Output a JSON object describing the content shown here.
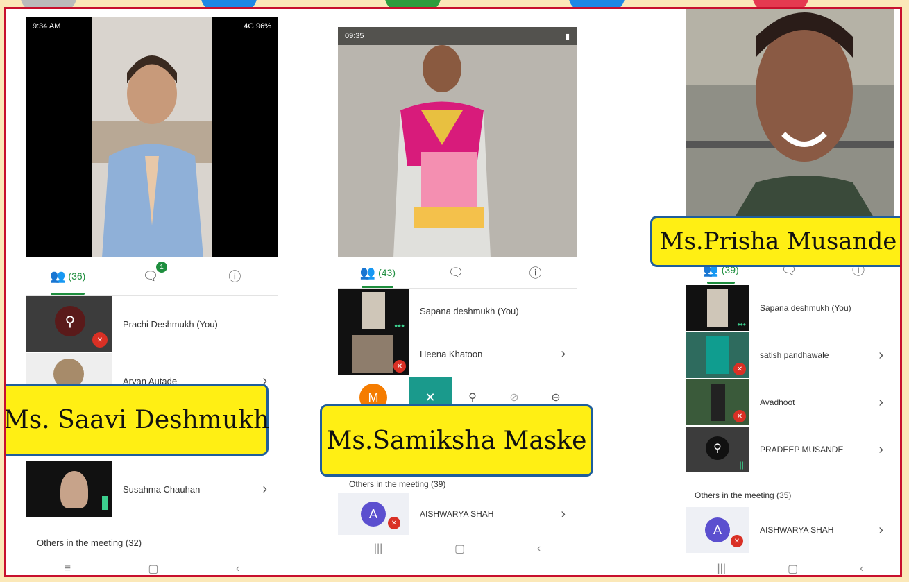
{
  "left": {
    "status_time": "9:34 AM",
    "status_right": "4G 96%",
    "tabs": {
      "people": "(36)",
      "chat_badge": "1"
    },
    "participants": [
      {
        "name": "Prachi Deshmukh (You)"
      },
      {
        "name": "Aryan Autade"
      },
      {
        "name": "Susahma Chauhan"
      }
    ],
    "others": "Others in the meeting (32)",
    "nameplate": "Ms. Saavi Deshmukh"
  },
  "middle": {
    "status_time": "09:35",
    "tabs": {
      "people": "(43)"
    },
    "participants": [
      {
        "name": "Sapana deshmukh (You)"
      },
      {
        "name": "Heena Khatoon"
      }
    ],
    "avatar_letter": "M",
    "others": "Others in the meeting (39)",
    "aishwarya": {
      "letter": "A",
      "name": "AISHWARYA SHAH"
    },
    "nameplate": "Ms.Samiksha Maske"
  },
  "right": {
    "tabs": {
      "people": "(39)"
    },
    "participants": [
      {
        "name": "Sapana deshmukh (You)"
      },
      {
        "name": "satish pandhawale"
      },
      {
        "name": "Avadhoot"
      },
      {
        "name": "PRADEEP MUSANDE"
      }
    ],
    "others": "Others in the meeting (35)",
    "aishwarya": {
      "letter": "A",
      "name": "AISHWARYA SHAH"
    },
    "nameplate": "Ms.Prisha  Musande"
  },
  "icons": {
    "people": "people-icon",
    "chat": "chat-icon",
    "info": "info-icon",
    "chevron": "chevron-right-icon",
    "mic_off": "mic-off-icon",
    "pin": "pin-icon"
  }
}
